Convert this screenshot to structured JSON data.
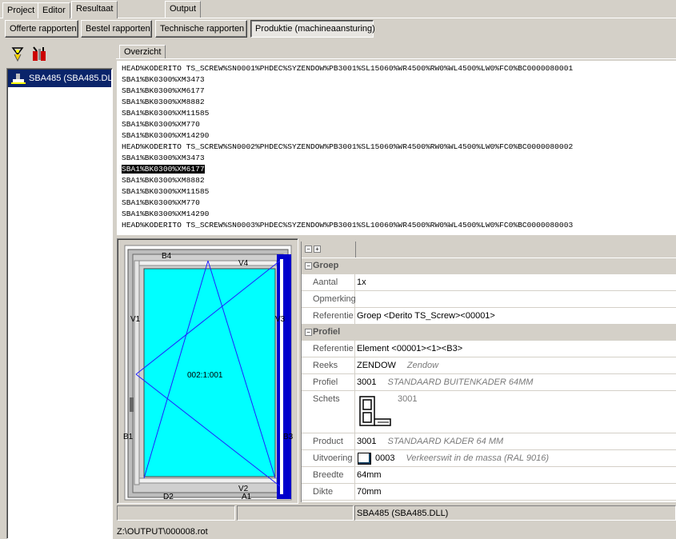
{
  "tabs": [
    "Project",
    "Editor",
    "Resultaat"
  ],
  "report_buttons": [
    "Offerte rapporten",
    "Bestel rapporten",
    "Technische rapporten",
    "Produktie (machineaansturing)"
  ],
  "tree": {
    "item": "SBA485 (SBA485.DLL)"
  },
  "view_tabs": [
    "Overzicht",
    "Output"
  ],
  "output_lines": [
    "HEAD%KODERITO TS_SCREW%SN0001%PHDEC%SYZENDOW%PB3001%SL15060%WR4500%RW0%WL4500%LW0%FC0%BC0000080001",
    "SBA1%BK0300%XM3473",
    "SBA1%BK0300%XM6177",
    "SBA1%BK0300%XM8882",
    "SBA1%BK0300%XM11585",
    "SBA1%BK0300%XM770",
    "SBA1%BK0300%XM14290",
    "HEAD%KODERITO TS_SCREW%SN0002%PHDEC%SYZENDOW%PB3001%SL15060%WR4500%RW0%WL4500%LW0%FC0%BC0000080002",
    "SBA1%BK0300%XM3473",
    "SBA1%BK0300%XM6177",
    "SBA1%BK0300%XM8882",
    "SBA1%BK0300%XM11585",
    "SBA1%BK0300%XM770",
    "SBA1%BK0300%XM14290",
    "HEAD%KODERITO TS_SCREW%SN0003%PHDEC%SYZENDOW%PB3001%SL10060%WR4500%RW0%WL4500%LW0%FC0%BC0000080003"
  ],
  "selected_line": 9,
  "drawing": {
    "top": "B4",
    "top_v": "V4",
    "left_v": "V1",
    "right_v": "V3",
    "left_b": "B1",
    "right_b": "B3",
    "bottom": "D2",
    "bottom_v": "V2",
    "bottom_a": "A1",
    "center": "002:1:001",
    "glass_color": "#00ffff",
    "frame_color": "#0000cc"
  },
  "properties": {
    "groep": {
      "title": "Groep",
      "aantal_label": "Aantal",
      "aantal": "1x",
      "opmerking_label": "Opmerking",
      "opmerking": "",
      "referentie_label": "Referentie",
      "referentie": "Groep <Derito TS_Screw><00001>"
    },
    "profiel": {
      "title": "Profiel",
      "referentie_label": "Referentie",
      "referentie": "Element <00001><1><B3>",
      "reeks_label": "Reeks",
      "reeks": "ZENDOW",
      "reeks_desc": "Zendow",
      "profiel_label": "Profiel",
      "profiel": "3001",
      "profiel_desc": "STANDAARD BUITENKADER 64MM",
      "schets_label": "Schets",
      "schets": "3001",
      "product_label": "Product",
      "product": "3001",
      "product_desc": "STANDAARD KADER 64 MM",
      "uitvoering_label": "Uitvoering",
      "uitvoering": "0003",
      "uitvoering_desc": "Verkeerswit in de massa (RAL 9016)",
      "breedte_label": "Breedte",
      "breedte": "64mm",
      "dikte_label": "Dikte",
      "dikte": "70mm"
    }
  },
  "status": {
    "right": "SBA485 (SBA485.DLL)",
    "path": "Z:\\OUTPUT\\000008.rot"
  }
}
